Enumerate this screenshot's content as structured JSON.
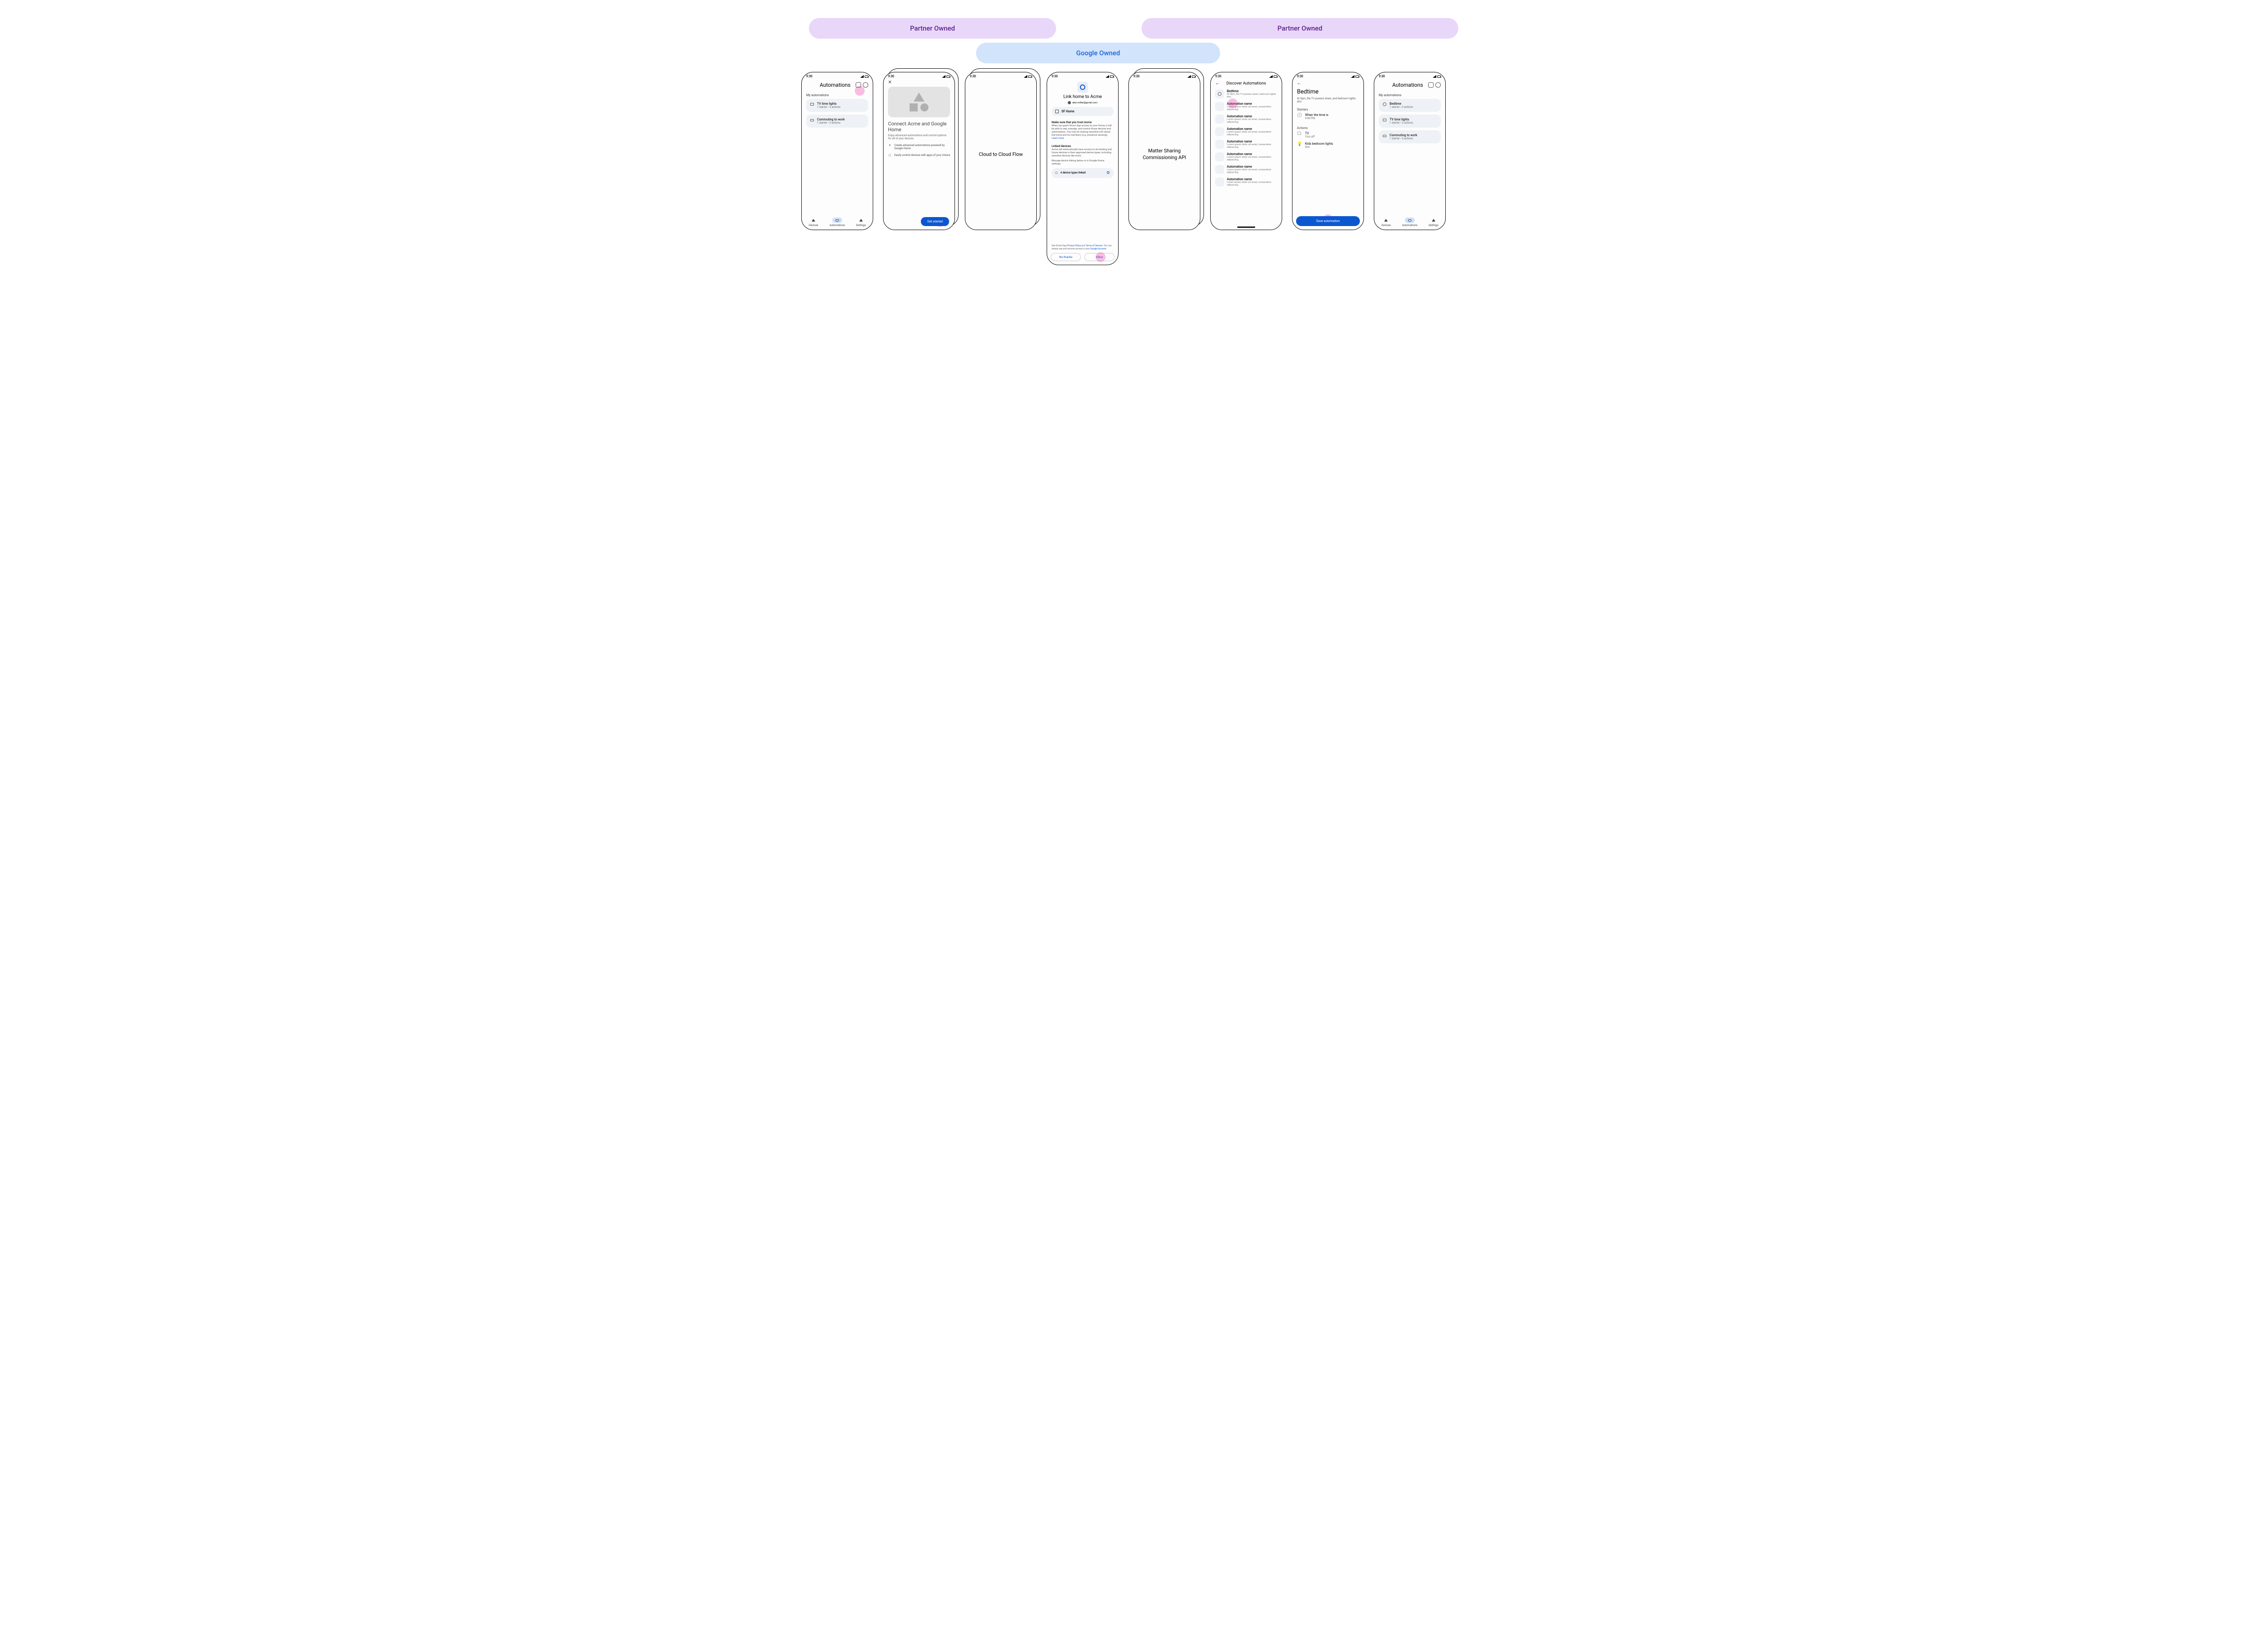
{
  "tags": {
    "partner1": "Partner Owned",
    "partner2": "Partner Owned",
    "google": "Google Owned"
  },
  "status_time": "9:30",
  "screen1": {
    "title": "Automations",
    "section": "My automations",
    "items": [
      {
        "title": "TV time lights",
        "sub": "1 starter • 2 actions"
      },
      {
        "title": "Commuting to work",
        "sub": "1 starter • 3 actions"
      }
    ],
    "nav": {
      "devices": "Devices",
      "automations": "Automations",
      "settings": "Settings"
    }
  },
  "screen2": {
    "title": "Connect Acme and Google Home",
    "sub": "Enjoy advanced automations and control options for all of your devices",
    "feat1": "Create advanced automations powered by Google Home",
    "feat2": "Easily control devices with apps of your choice",
    "cta": "Get started"
  },
  "screen3": {
    "title": "Cloud to Cloud Flow"
  },
  "screen4": {
    "title": "Link home to Acme",
    "email": "alex.miller@gmail.com",
    "home": "SF Home",
    "trust_h": "Make sure that you trust Acme",
    "trust_b": "When you grant Smart App access to your Home, it will be able to  see, manage, and control those devices and automations. You may be sharing sensitive info about the home and its members (e.g. presence sensing). ",
    "learn": "Learn more",
    "linked_h": "Linked devices",
    "linked_b1": "Acme will automatically have access to all existing and future devices in their approved device types, including sensitive devices like locks.",
    "linked_b2": "Manage device linking below or in Google Home settings.",
    "devcount": "4 device types linked",
    "fineprint_a": "See Smart App ",
    "fineprint_pp": "Privacy Policy",
    "fineprint_and": " and ",
    "fineprint_tos": "Terms of Service",
    "fineprint_b": ". You can always see and remove access in your ",
    "fineprint_ga": "Google Account",
    "btn_no": "No thanks",
    "btn_allow": "Allow"
  },
  "screen5": {
    "title": "Matter Sharing Commissioning API"
  },
  "screen6": {
    "title": "Discover Automations",
    "first": {
      "title": "Bedtime",
      "sub": "At 9pm, the TV powers down, bedroom lights dim."
    },
    "generic": {
      "title": "Automation name",
      "sub": "Lorem ipsum dolor sit amet, consectetur adipiscing."
    }
  },
  "screen7": {
    "title": "Bedtime",
    "sub": "At 9pm, the TV powers down, and bedroom lights dim.",
    "starters_lbl": "Starters",
    "starter_t": "When the time is",
    "starter_s": "9:00 PM",
    "actions_lbl": "Actions",
    "a1_t": "TV",
    "a1_s": "Turn off",
    "a2_t": "Kids bedroom lights",
    "a2_s": "Dim",
    "cta": "Save automation"
  },
  "screen8": {
    "title": "Automations",
    "section": "My automations",
    "items": [
      {
        "title": "Bedtime",
        "sub": "1 starter • 2 actions"
      },
      {
        "title": "TV time lights",
        "sub": "1 starter • 2 actions"
      },
      {
        "title": "Commuting to work",
        "sub": "1 starter • 3 actions"
      }
    ],
    "nav": {
      "devices": "Devices",
      "automations": "Automations",
      "settings": "Settings"
    }
  }
}
